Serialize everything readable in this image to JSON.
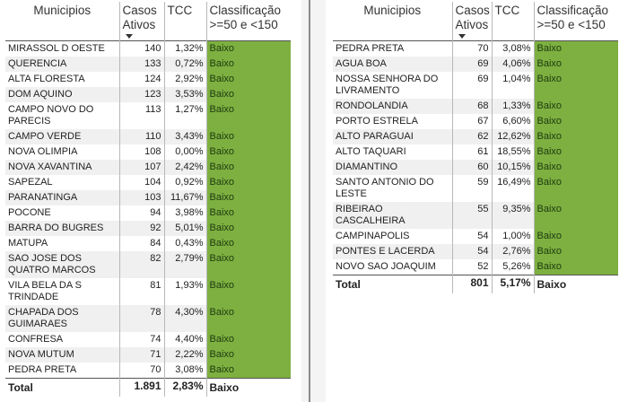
{
  "headers": {
    "municipios": "Municipios",
    "casos": "Casos Ativos",
    "tcc": "TCC",
    "classificacao": "Classificação >=50 e <150"
  },
  "left": {
    "rows": [
      {
        "municipio": "MIRASSOL D OESTE",
        "casos": "140",
        "tcc": "1,32%",
        "cls": "Baixo"
      },
      {
        "municipio": "QUERENCIA",
        "casos": "133",
        "tcc": "0,72%",
        "cls": "Baixo"
      },
      {
        "municipio": "ALTA FLORESTA",
        "casos": "124",
        "tcc": "2,92%",
        "cls": "Baixo"
      },
      {
        "municipio": "DOM AQUINO",
        "casos": "123",
        "tcc": "3,53%",
        "cls": "Baixo"
      },
      {
        "municipio": "CAMPO NOVO DO PARECIS",
        "casos": "113",
        "tcc": "1,27%",
        "cls": "Baixo"
      },
      {
        "municipio": "CAMPO VERDE",
        "casos": "110",
        "tcc": "3,43%",
        "cls": "Baixo"
      },
      {
        "municipio": "NOVA OLIMPIA",
        "casos": "108",
        "tcc": "0,00%",
        "cls": "Baixo"
      },
      {
        "municipio": "NOVA XAVANTINA",
        "casos": "107",
        "tcc": "2,42%",
        "cls": "Baixo"
      },
      {
        "municipio": "SAPEZAL",
        "casos": "104",
        "tcc": "0,92%",
        "cls": "Baixo"
      },
      {
        "municipio": "PARANATINGA",
        "casos": "103",
        "tcc": "11,67%",
        "cls": "Baixo"
      },
      {
        "municipio": "POCONE",
        "casos": "94",
        "tcc": "3,98%",
        "cls": "Baixo"
      },
      {
        "municipio": "BARRA DO BUGRES",
        "casos": "92",
        "tcc": "5,01%",
        "cls": "Baixo"
      },
      {
        "municipio": "MATUPA",
        "casos": "84",
        "tcc": "0,43%",
        "cls": "Baixo"
      },
      {
        "municipio": "SAO JOSE DOS QUATRO MARCOS",
        "casos": "82",
        "tcc": "2,79%",
        "cls": "Baixo"
      },
      {
        "municipio": "VILA BELA DA S TRINDADE",
        "casos": "81",
        "tcc": "1,93%",
        "cls": "Baixo"
      },
      {
        "municipio": "CHAPADA DOS GUIMARAES",
        "casos": "78",
        "tcc": "4,30%",
        "cls": "Baixo"
      },
      {
        "municipio": "CONFRESA",
        "casos": "74",
        "tcc": "4,40%",
        "cls": "Baixo"
      },
      {
        "municipio": "NOVA MUTUM",
        "casos": "71",
        "tcc": "2,22%",
        "cls": "Baixo"
      },
      {
        "municipio": "PEDRA PRETA",
        "casos": "70",
        "tcc": "3,08%",
        "cls": "Baixo"
      }
    ],
    "total": {
      "label": "Total",
      "casos": "1.891",
      "tcc": "2,83%",
      "cls": "Baixo"
    }
  },
  "right": {
    "rows": [
      {
        "municipio": "PEDRA PRETA",
        "casos": "70",
        "tcc": "3,08%",
        "cls": "Baixo"
      },
      {
        "municipio": "AGUA BOA",
        "casos": "69",
        "tcc": "4,06%",
        "cls": "Baixo"
      },
      {
        "municipio": "NOSSA SENHORA DO LIVRAMENTO",
        "casos": "69",
        "tcc": "1,04%",
        "cls": "Baixo"
      },
      {
        "municipio": "RONDOLANDIA",
        "casos": "68",
        "tcc": "1,33%",
        "cls": "Baixo"
      },
      {
        "municipio": "PORTO ESTRELA",
        "casos": "67",
        "tcc": "6,60%",
        "cls": "Baixo"
      },
      {
        "municipio": "ALTO PARAGUAI",
        "casos": "62",
        "tcc": "12,62%",
        "cls": "Baixo"
      },
      {
        "municipio": "ALTO TAQUARI",
        "casos": "61",
        "tcc": "18,55%",
        "cls": "Baixo"
      },
      {
        "municipio": "DIAMANTINO",
        "casos": "60",
        "tcc": "10,15%",
        "cls": "Baixo"
      },
      {
        "municipio": "SANTO ANTONIO DO LESTE",
        "casos": "59",
        "tcc": "16,49%",
        "cls": "Baixo"
      },
      {
        "municipio": "RIBEIRAO CASCALHEIRA",
        "casos": "55",
        "tcc": "9,35%",
        "cls": "Baixo"
      },
      {
        "municipio": "CAMPINAPOLIS",
        "casos": "54",
        "tcc": "1,00%",
        "cls": "Baixo"
      },
      {
        "municipio": "PONTES E LACERDA",
        "casos": "54",
        "tcc": "2,76%",
        "cls": "Baixo"
      },
      {
        "municipio": "NOVO SAO JOAQUIM",
        "casos": "52",
        "tcc": "5,26%",
        "cls": "Baixo"
      }
    ],
    "total": {
      "label": "Total",
      "casos": "801",
      "tcc": "5,17%",
      "cls": "Baixo"
    }
  },
  "colors": {
    "baixo": "#7db040"
  }
}
